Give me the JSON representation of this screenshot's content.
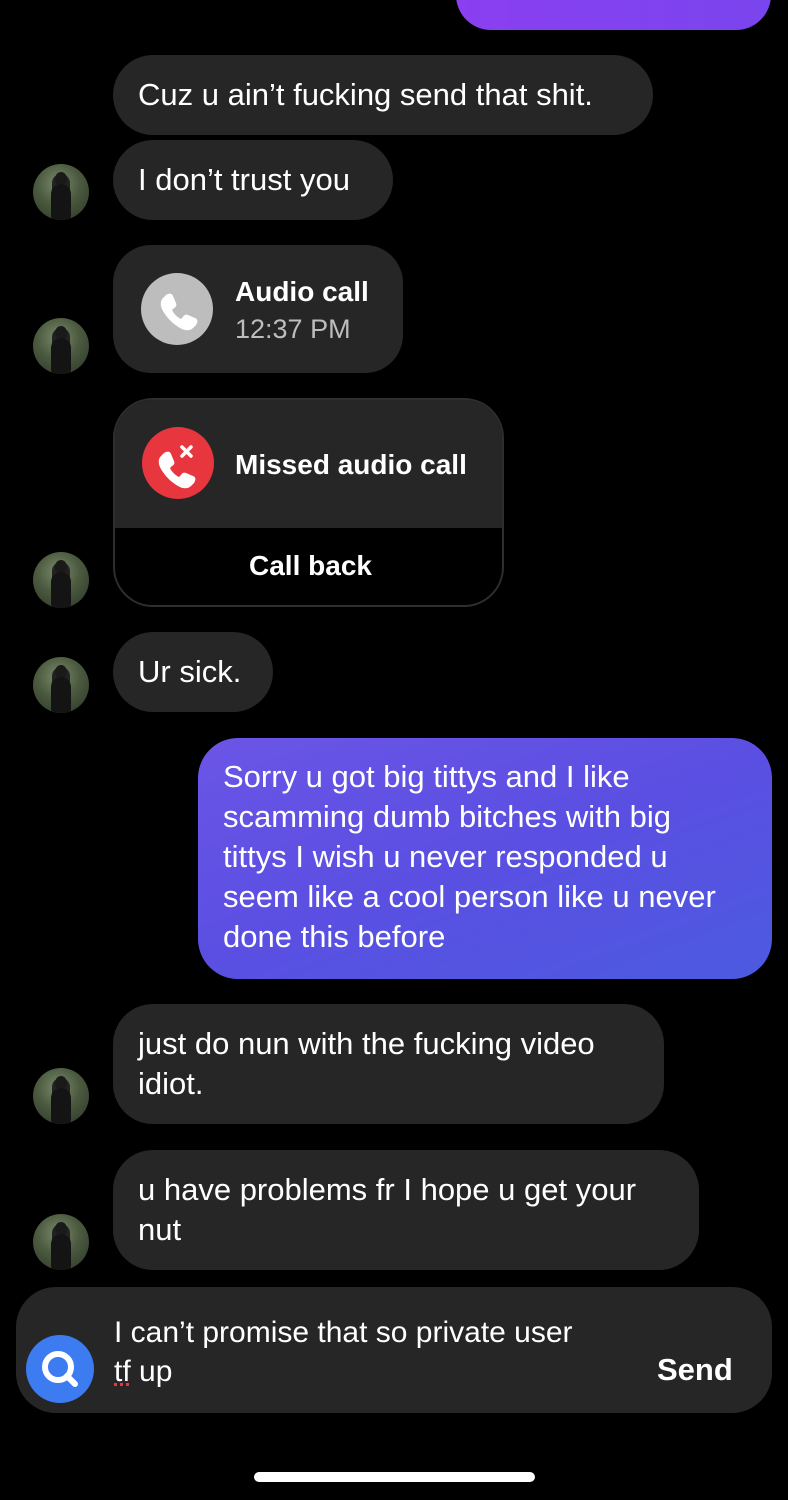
{
  "messages": {
    "m1": "Cuz u ain’t fucking send that shit.",
    "m2": "I don’t trust you",
    "call": {
      "title": "Audio call",
      "time": "12:37 PM"
    },
    "missed": {
      "title": "Missed audio call",
      "action": "Call back"
    },
    "m3": "Ur sick.",
    "sent1": [
      "Sorry u got big tittys and I like",
      "scamming dumb bitches with big",
      "tittys I wish u never responded u",
      "seem like a cool person like u never",
      "done this before"
    ],
    "m4": [
      "just do nun with the fucking video",
      "idiot."
    ],
    "m5": [
      "u have problems fr I hope u get your",
      "nut"
    ]
  },
  "composer": {
    "line1": "I can’t promise that so private user",
    "line2a": "tf",
    "line2b": " up",
    "send_label": "Send"
  },
  "icons": {
    "phone": "phone-icon",
    "missed": "missed-call-icon",
    "search": "search-icon"
  },
  "colors": {
    "sent_bubble": "#5a4fe2",
    "received_bubble": "#262626",
    "missed_red": "#e8363f",
    "accent_blue": "#3c7bf0"
  }
}
